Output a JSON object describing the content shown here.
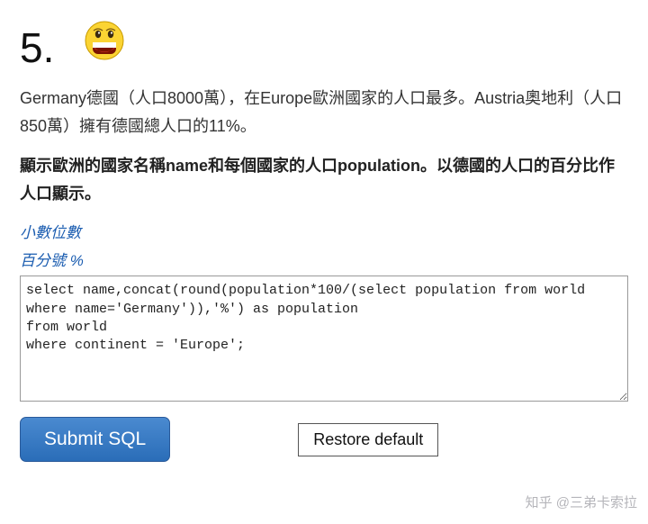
{
  "header": {
    "number": "5.",
    "emoji_alt": "grinning-face-icon"
  },
  "body_text": "Germany德國（人口8000萬），在Europe歐洲國家的人口最多。Austria奧地利（人口850萬）擁有德國總人口的11%。",
  "instruction": "顯示歐洲的國家名稱name和每個國家的人口population。以德國的人口的百分比作人口顯示。",
  "hints": {
    "decimal": "小數位數",
    "percent": "百分號 %"
  },
  "editor": {
    "sql": "select name,concat(round(population*100/(select population from world where name='Germany')),'%') as population\nfrom world\nwhere continent = 'Europe';"
  },
  "buttons": {
    "submit": "Submit SQL",
    "restore": "Restore default"
  },
  "watermark": "知乎 @三弟卡索拉"
}
